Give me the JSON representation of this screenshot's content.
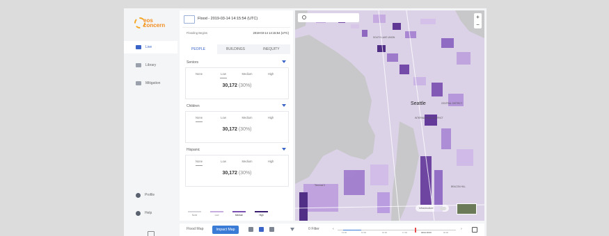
{
  "sidebar": {
    "logo": {
      "line1": "eos",
      "line2": "concern"
    },
    "items": [
      {
        "label": "Live",
        "icon": "live-icon",
        "active": true
      },
      {
        "label": "Library",
        "icon": "library-icon",
        "active": false
      },
      {
        "label": "Mitigation",
        "icon": "mitigation-icon",
        "active": false
      }
    ],
    "bottom_items": [
      {
        "label": "Profile",
        "icon": "profile-icon"
      },
      {
        "label": "Help",
        "icon": "help-icon"
      }
    ]
  },
  "panel": {
    "flood_title": "Flood - 2019-03-14 14:15:54 (UTC)",
    "begins_label": "Flooding Begins",
    "begins_value": "2019-03-14 14:15:54 (UTC)",
    "tabs": [
      "PEOPLE",
      "BUILDINGS",
      "INEQUITY"
    ],
    "active_tab": "PEOPLE",
    "levels": [
      "None",
      "Low",
      "Medium",
      "High"
    ],
    "sections": [
      {
        "title": "Seniors",
        "value": "30,172",
        "pct": "(30%)",
        "selected_level": "Low"
      },
      {
        "title": "Children",
        "value": "30,172",
        "pct": "(30%)",
        "selected_level": "None"
      },
      {
        "title": "Hispanic",
        "value": "30,172",
        "pct": "(30%)",
        "selected_level": "None"
      }
    ],
    "legend": [
      {
        "label": "None",
        "color": "#d6d6da"
      },
      {
        "label": "Low",
        "color": "#c8aee0"
      },
      {
        "label": "Medium",
        "color": "#7a4fb0"
      },
      {
        "label": "High",
        "color": "#3a1d6e"
      }
    ]
  },
  "map": {
    "zoom_in": "+",
    "zoom_out": "−",
    "city_label": "Seattle",
    "labels": [
      "SOUTH LAKE UNION",
      "INTERNATIONAL DISTRICT",
      "CENTRAL DISTRICT",
      "BEACON HILL",
      "Terminal 5"
    ],
    "infrastructure_label": "Infrastructure"
  },
  "bottom_bar": {
    "flood_map": "Flood Map",
    "impact_map": "Impact Map",
    "filter": "0 Filter",
    "timeline_ticks": [
      "13:00",
      "14:00",
      "16:00",
      "17:00",
      "04/12 00:00",
      "02:00"
    ],
    "prev": "‹",
    "next": "›"
  },
  "colors": {
    "accent": "#3a64c7",
    "brand_orange": "#f28c1e"
  }
}
